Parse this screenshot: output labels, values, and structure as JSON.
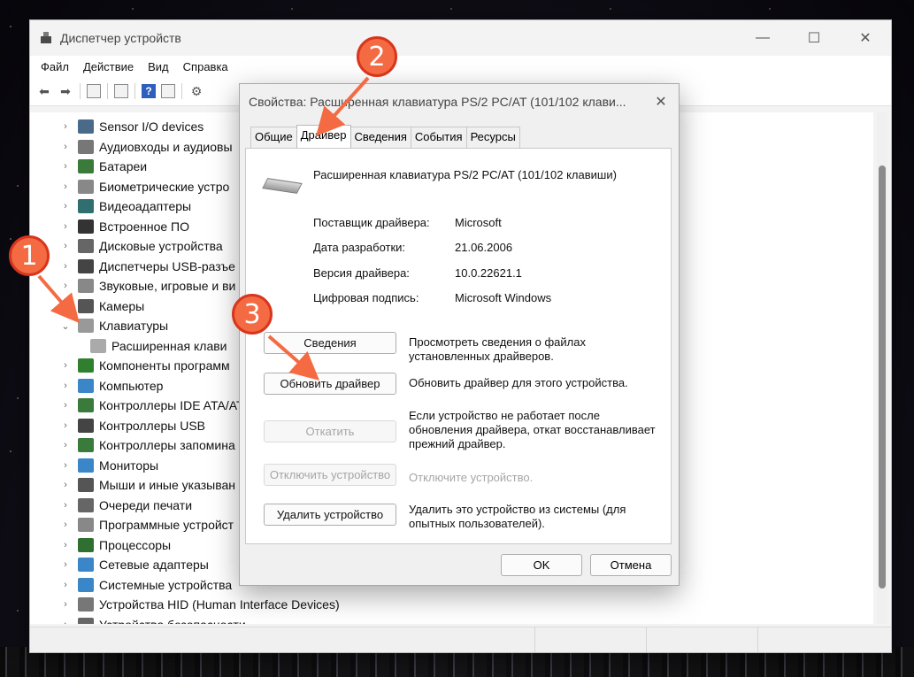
{
  "window": {
    "title": "Диспетчер устройств",
    "minimize": "—",
    "maximize": "☐",
    "close": "✕"
  },
  "menu": [
    "Файл",
    "Действие",
    "Вид",
    "Справка"
  ],
  "toolbar_icons": [
    "back-icon",
    "forward-icon",
    "show-hide-tree-icon",
    "properties-icon",
    "help-icon",
    "view-icon",
    "scan-icon"
  ],
  "tree": [
    {
      "label": "Sensor I/O devices",
      "color": "#4a6a8a"
    },
    {
      "label": "Аудиовходы и аудиовы",
      "color": "#777777"
    },
    {
      "label": "Батареи",
      "color": "#3a7a3a"
    },
    {
      "label": "Биометрические устро",
      "color": "#888888"
    },
    {
      "label": "Видеоадаптеры",
      "color": "#2f6f6f"
    },
    {
      "label": "Встроенное ПО",
      "color": "#333333"
    },
    {
      "label": "Дисковые устройства",
      "color": "#666666"
    },
    {
      "label": "Диспетчеры USB-разъе",
      "color": "#444444"
    },
    {
      "label": "Звуковые, игровые и ви",
      "color": "#888888"
    },
    {
      "label": "Камеры",
      "color": "#555555"
    },
    {
      "label": "Клавиатуры",
      "color": "#999999",
      "expanded": true
    },
    {
      "label": "Расширенная клави",
      "color": "#aaaaaa",
      "child": true
    },
    {
      "label": "Компоненты программ",
      "color": "#2f7f2f"
    },
    {
      "label": "Компьютер",
      "color": "#3a86c8"
    },
    {
      "label": "Контроллеры IDE ATA/AT",
      "color": "#3a7a3a"
    },
    {
      "label": "Контроллеры USB",
      "color": "#444444"
    },
    {
      "label": "Контроллеры запомина",
      "color": "#3a7a3a"
    },
    {
      "label": "Мониторы",
      "color": "#3a86c8"
    },
    {
      "label": "Мыши и иные указыван",
      "color": "#555555"
    },
    {
      "label": "Очереди печати",
      "color": "#666666"
    },
    {
      "label": "Программные устройст",
      "color": "#888888"
    },
    {
      "label": "Процессоры",
      "color": "#2f6f2f"
    },
    {
      "label": "Сетевые адаптеры",
      "color": "#3a86c8"
    },
    {
      "label": "Системные устройства",
      "color": "#3a86c8"
    },
    {
      "label": "Устройства HID (Human Interface Devices)",
      "color": "#777777"
    },
    {
      "label": "Устройства безопасности",
      "color": "#666666"
    }
  ],
  "dialog": {
    "title": "Свойства: Расширенная клавиатура PS/2 PC/AT (101/102 клави...",
    "close": "✕",
    "tabs": [
      "Общие",
      "Драйвер",
      "Сведения",
      "События",
      "Ресурсы"
    ],
    "active_tab": "Драйвер",
    "device_name": "Расширенная клавиатура PS/2 PC/AT (101/102 клавиши)",
    "props": [
      {
        "label": "Поставщик драйвера:",
        "value": "Microsoft"
      },
      {
        "label": "Дата разработки:",
        "value": "21.06.2006"
      },
      {
        "label": "Версия драйвера:",
        "value": "10.0.22621.1"
      },
      {
        "label": "Цифровая подпись:",
        "value": "Microsoft Windows"
      }
    ],
    "buttons": {
      "details": "Сведения",
      "details_desc": "Просмотреть сведения о файлах установленных драйверов.",
      "update": "Обновить драйвер",
      "update_desc": "Обновить драйвер для этого устройства.",
      "rollback": "Откатить",
      "rollback_desc": "Если устройство не работает после обновления драйвера, откат восстанавливает прежний драйвер.",
      "disable": "Отключить устройство",
      "disable_desc": "Отключите устройство.",
      "uninstall": "Удалить устройство",
      "uninstall_desc": "Удалить это устройство из системы (для опытных пользователей)."
    },
    "ok": "OK",
    "cancel": "Отмена"
  },
  "annotations": [
    "1",
    "2",
    "3"
  ],
  "accent": "#f46a43"
}
